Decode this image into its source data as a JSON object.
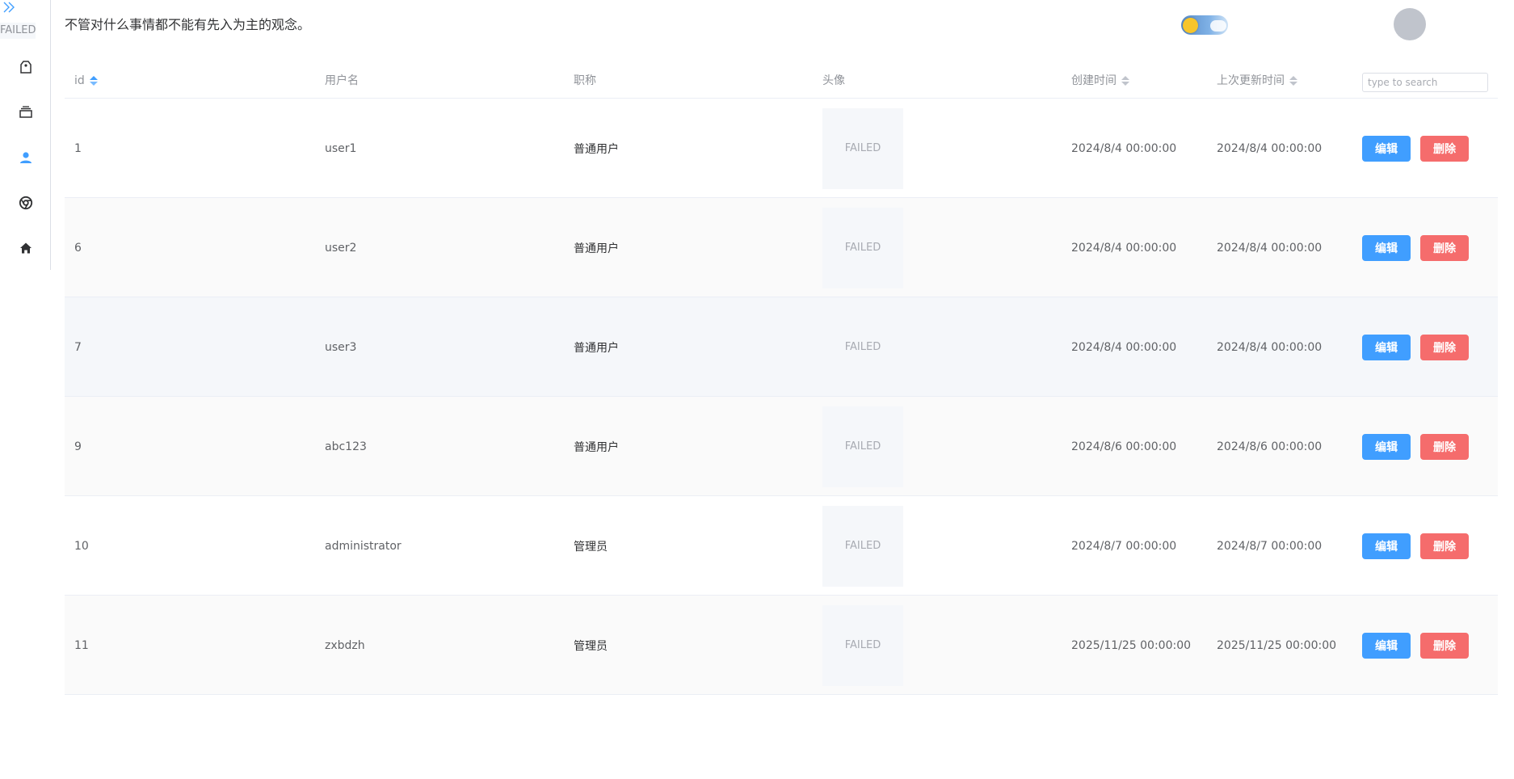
{
  "sidebar": {
    "logo_text": "FAILED",
    "items": [
      {
        "icon": "price-tag-icon"
      },
      {
        "icon": "box-icon"
      },
      {
        "icon": "user-icon",
        "active": true
      },
      {
        "icon": "chrome-icon"
      },
      {
        "icon": "home-icon"
      }
    ]
  },
  "header": {
    "quote": "不管对什么事情都不能有先入为主的观念。"
  },
  "table": {
    "columns": {
      "id": "id",
      "username": "用户名",
      "title": "职称",
      "avatar": "头像",
      "created": "创建时间",
      "updated": "上次更新时间"
    },
    "search_placeholder": "type to search",
    "rows": [
      {
        "id": "1",
        "username": "user1",
        "title": "普通用户",
        "avatar": "FAILED",
        "created": "2024/8/4 00:00:00",
        "updated": "2024/8/4 00:00:00",
        "edit": "编辑",
        "delete": "删除"
      },
      {
        "id": "6",
        "username": "user2",
        "title": "普通用户",
        "avatar": "FAILED",
        "created": "2024/8/4 00:00:00",
        "updated": "2024/8/4 00:00:00",
        "edit": "编辑",
        "delete": "删除"
      },
      {
        "id": "7",
        "username": "user3",
        "title": "普通用户",
        "avatar": "FAILED",
        "created": "2024/8/4 00:00:00",
        "updated": "2024/8/4 00:00:00",
        "edit": "编辑",
        "delete": "删除"
      },
      {
        "id": "9",
        "username": "abc123",
        "title": "普通用户",
        "avatar": "FAILED",
        "created": "2024/8/6 00:00:00",
        "updated": "2024/8/6 00:00:00",
        "edit": "编辑",
        "delete": "删除"
      },
      {
        "id": "10",
        "username": "administrator",
        "title": "管理员",
        "avatar": "FAILED",
        "created": "2024/8/7 00:00:00",
        "updated": "2024/8/7 00:00:00",
        "edit": "编辑",
        "delete": "删除"
      },
      {
        "id": "11",
        "username": "zxbdzh",
        "title": "管理员",
        "avatar": "FAILED",
        "created": "2025/11/25 00:00:00",
        "updated": "2025/11/25 00:00:00",
        "edit": "编辑",
        "delete": "删除"
      }
    ]
  },
  "colors": {
    "primary": "#409eff",
    "danger": "#f56c6c",
    "sun": "#f7c52b"
  }
}
